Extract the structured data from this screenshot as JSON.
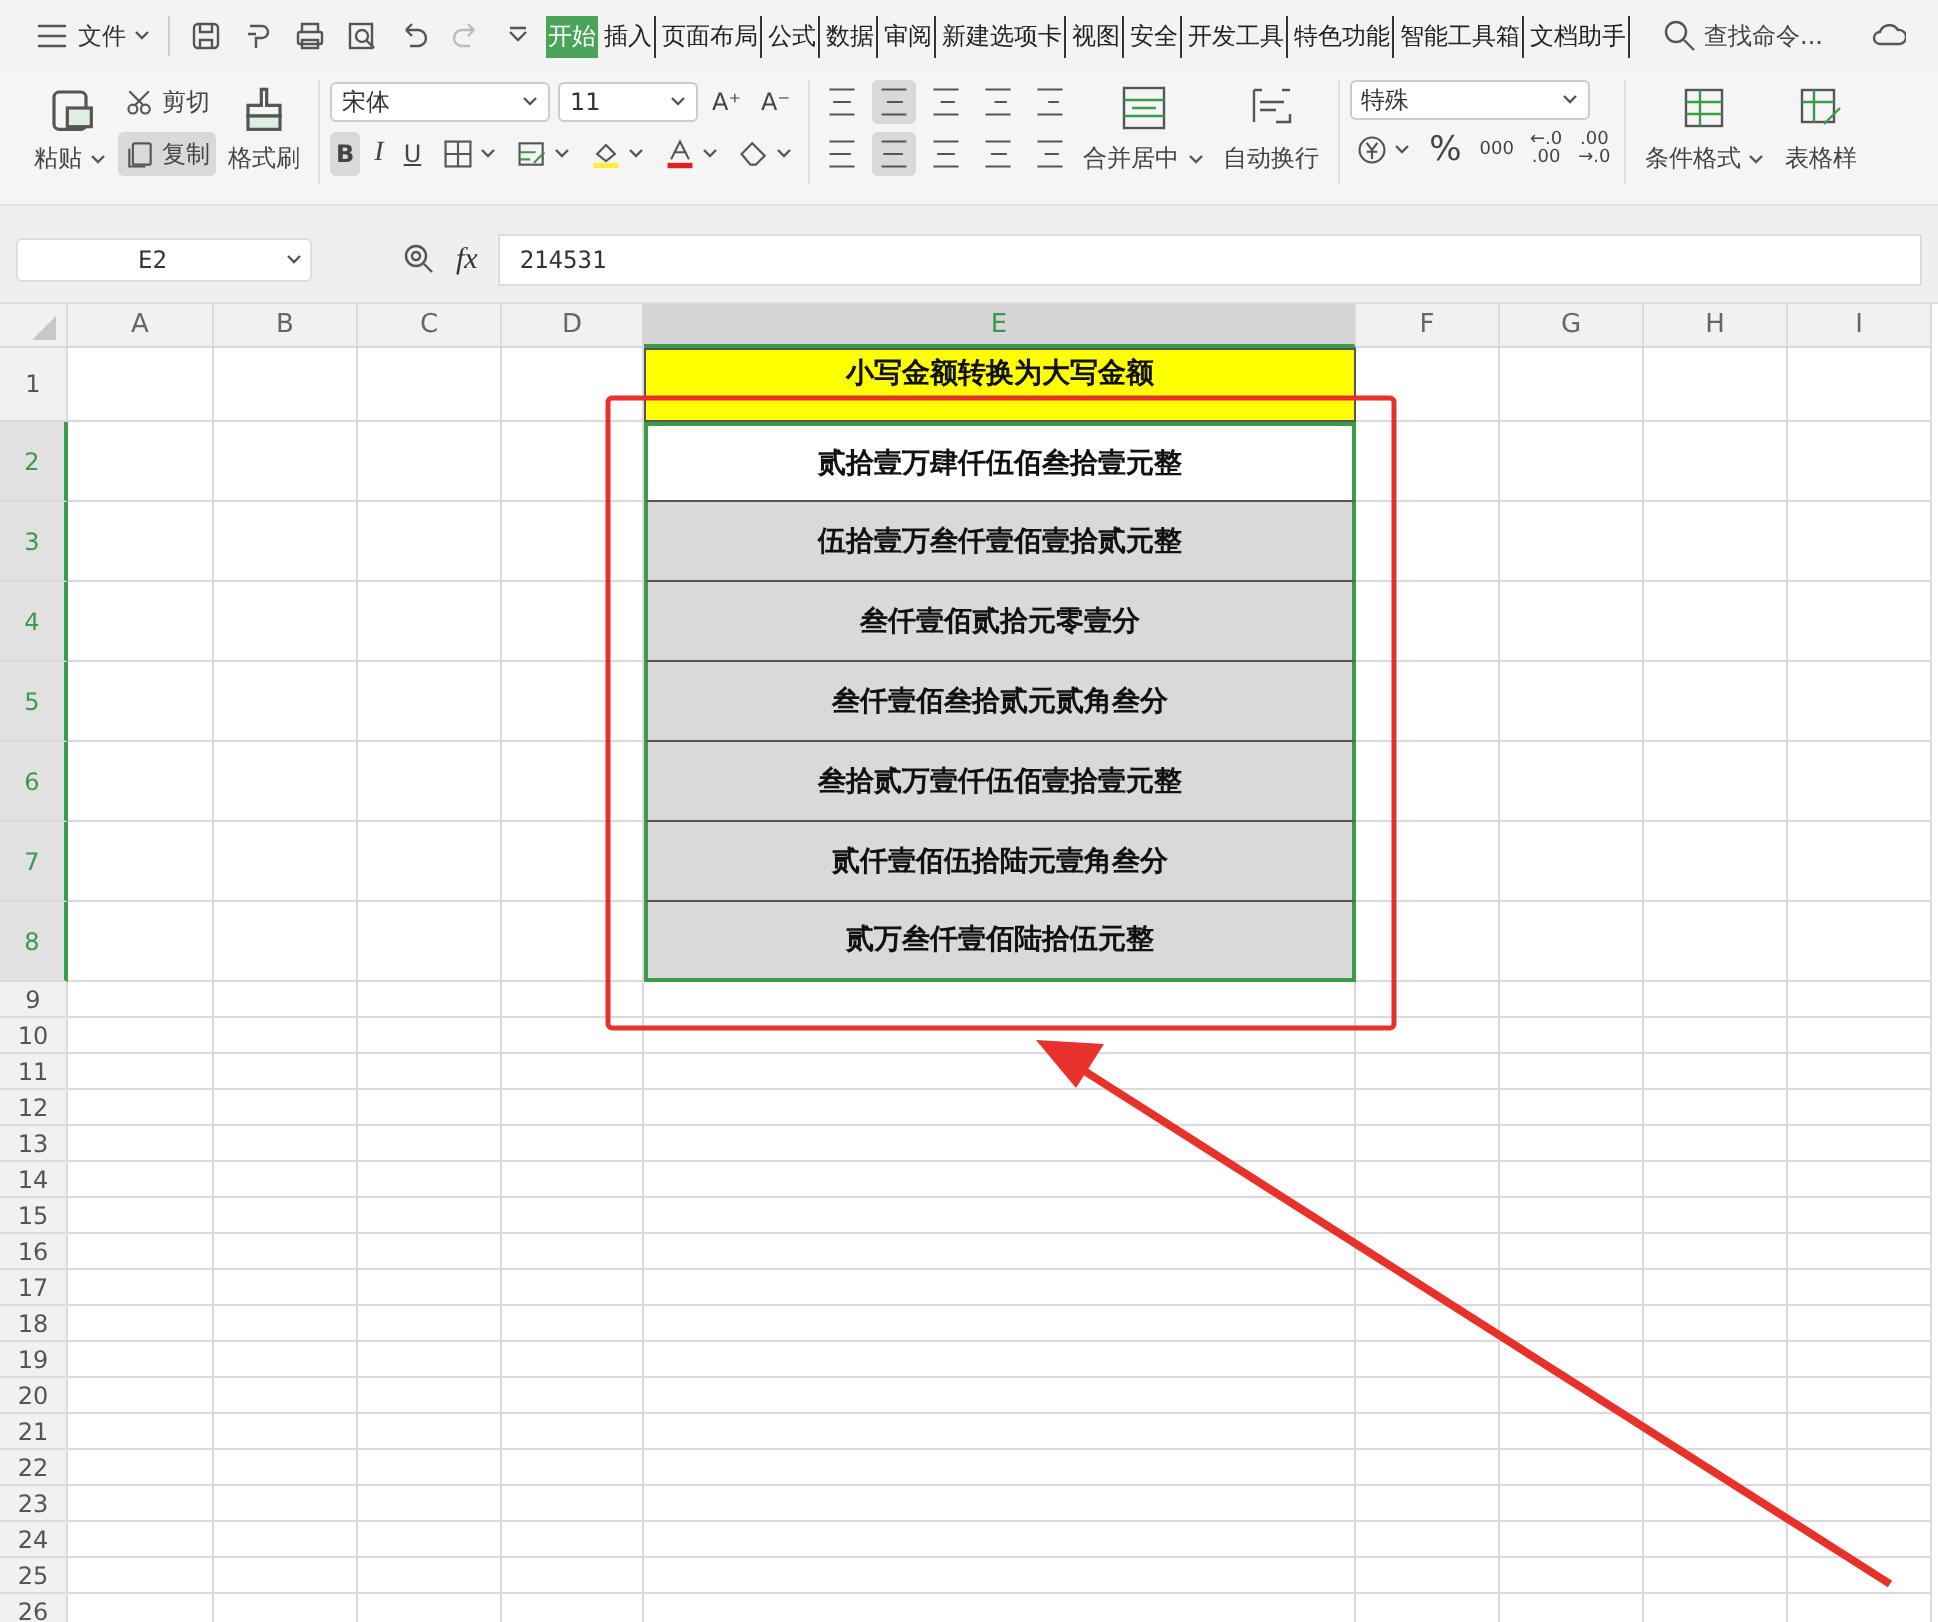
{
  "menu": {
    "file_label": "文件"
  },
  "tabs": [
    {
      "label": "开始",
      "selected": true
    },
    {
      "label": "插入",
      "selected": false
    },
    {
      "label": "页面布局",
      "selected": false
    },
    {
      "label": "公式",
      "selected": false
    },
    {
      "label": "数据",
      "selected": false
    },
    {
      "label": "审阅",
      "selected": false
    },
    {
      "label": "新建选项卡",
      "selected": false
    },
    {
      "label": "视图",
      "selected": false
    },
    {
      "label": "安全",
      "selected": false
    },
    {
      "label": "开发工具",
      "selected": false
    },
    {
      "label": "特色功能",
      "selected": false
    },
    {
      "label": "智能工具箱",
      "selected": false
    },
    {
      "label": "文档助手",
      "selected": false
    }
  ],
  "search": {
    "placeholder": "查找命令..."
  },
  "ribbon": {
    "paste": "粘贴",
    "cut": "剪切",
    "copy": {
      "label": "复制",
      "selected": true
    },
    "format_painter": "格式刷",
    "font": "宋体",
    "font_size": "11",
    "grow": "A⁺",
    "shrink": "A⁻",
    "bold": {
      "label": "B",
      "selected": true
    },
    "italic": {
      "label": "I",
      "selected": false
    },
    "underline": {
      "label": "U",
      "selected": false
    },
    "merge": "合并居中",
    "wrap": "自动换行",
    "number_format": "特殊",
    "percent": "%",
    "thousands": "000",
    "inc_decimal": [
      "←.0",
      ".00"
    ],
    "dec_decimal": [
      ".00",
      "→.0"
    ],
    "conditional": "条件格式",
    "table_style": "表格样"
  },
  "name_box": "E2",
  "fx": "fx",
  "formula": "214531",
  "columns": [
    {
      "label": "A",
      "selected": false
    },
    {
      "label": "B",
      "selected": false
    },
    {
      "label": "C",
      "selected": false
    },
    {
      "label": "D",
      "selected": false
    },
    {
      "label": "E",
      "selected": true
    },
    {
      "label": "F",
      "selected": false
    },
    {
      "label": "G",
      "selected": false
    },
    {
      "label": "H",
      "selected": false
    },
    {
      "label": "I",
      "selected": false
    }
  ],
  "rows": [
    {
      "label": "1",
      "selected": false,
      "e": {
        "text": "小写金额转换为大写金额",
        "kind": "header"
      }
    },
    {
      "label": "2",
      "selected": true,
      "e": {
        "text": "贰拾壹万肆仟伍佰叁拾壹元整",
        "kind": "active"
      }
    },
    {
      "label": "3",
      "selected": true,
      "e": {
        "text": "伍拾壹万叁仟壹佰壹拾贰元整",
        "kind": "range"
      }
    },
    {
      "label": "4",
      "selected": true,
      "e": {
        "text": "叁仟壹佰贰拾元零壹分",
        "kind": "range"
      }
    },
    {
      "label": "5",
      "selected": true,
      "e": {
        "text": "叁仟壹佰叁拾贰元贰角叁分",
        "kind": "range"
      }
    },
    {
      "label": "6",
      "selected": true,
      "e": {
        "text": "叁拾贰万壹仟伍佰壹拾壹元整",
        "kind": "range"
      }
    },
    {
      "label": "7",
      "selected": true,
      "e": {
        "text": "贰仟壹佰伍拾陆元壹角叁分",
        "kind": "range"
      }
    },
    {
      "label": "8",
      "selected": true,
      "e": {
        "text": "贰万叁仟壹佰陆拾伍元整",
        "kind": "range"
      }
    },
    {
      "label": "9",
      "selected": false
    },
    {
      "label": "10",
      "selected": false
    },
    {
      "label": "11",
      "selected": false
    },
    {
      "label": "12",
      "selected": false
    },
    {
      "label": "13",
      "selected": false
    },
    {
      "label": "14",
      "selected": false
    },
    {
      "label": "15",
      "selected": false
    },
    {
      "label": "16",
      "selected": false
    },
    {
      "label": "17",
      "selected": false
    },
    {
      "label": "18",
      "selected": false
    },
    {
      "label": "19",
      "selected": false
    },
    {
      "label": "20",
      "selected": false
    },
    {
      "label": "21",
      "selected": false
    },
    {
      "label": "22",
      "selected": false
    },
    {
      "label": "23",
      "selected": false
    },
    {
      "label": "24",
      "selected": false
    },
    {
      "label": "25",
      "selected": false
    },
    {
      "label": "26",
      "selected": false
    }
  ]
}
